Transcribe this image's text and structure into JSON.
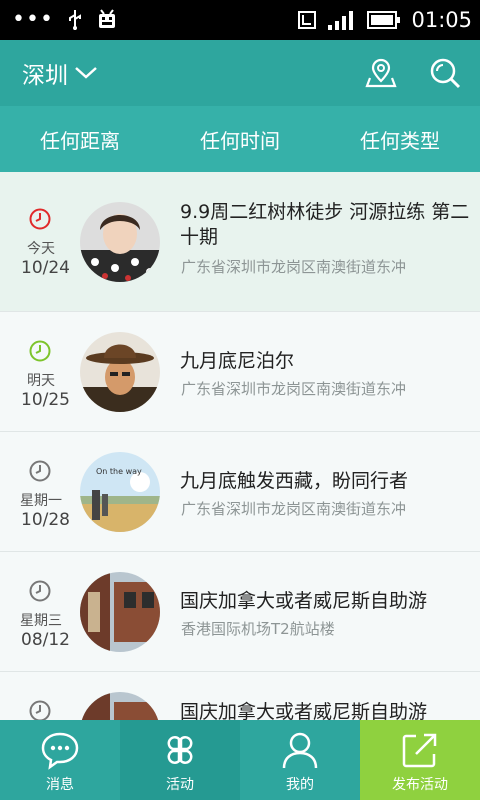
{
  "status_bar": {
    "left_icons": [
      "overflow-dots-icon",
      "usb-icon",
      "android-debug-icon"
    ],
    "right_icons": [
      "vibrate-icon",
      "signal-icon",
      "battery-icon"
    ],
    "time": "01:05"
  },
  "header": {
    "city": "深圳",
    "icons": [
      "location-map-icon",
      "search-icon"
    ]
  },
  "filters": [
    {
      "label": "任何距离"
    },
    {
      "label": "任何时间"
    },
    {
      "label": "任何类型"
    }
  ],
  "activities": [
    {
      "day": "今天",
      "date": "10/24",
      "title": "9.9周二红树林徒步  河源拉练  第二十期",
      "address": "广东省深圳市龙岗区南澳街道东冲",
      "clock_color": "#e02a2a"
    },
    {
      "day": "明天",
      "date": "10/25",
      "title": "九月底尼泊尔",
      "address": "广东省深圳市龙岗区南澳街道东冲",
      "clock_color": "#7dc42b"
    },
    {
      "day": "星期一",
      "date": "10/28",
      "title": "九月底触发西藏，盼同行者",
      "address": "广东省深圳市龙岗区南澳街道东冲",
      "clock_color": "#777777"
    },
    {
      "day": "星期三",
      "date": "08/12",
      "title": "国庆加拿大或者威尼斯自助游",
      "address": "香港国际机场T2航站楼",
      "clock_color": "#777777"
    },
    {
      "day": "",
      "date": "",
      "title": "国庆加拿大或者威尼斯自助游",
      "address": "",
      "clock_color": "#777777"
    }
  ],
  "bottom_nav": [
    {
      "label": "消息",
      "icon": "message-bubble-icon"
    },
    {
      "label": "活动",
      "icon": "activity-grid-icon"
    },
    {
      "label": "我的",
      "icon": "user-profile-icon"
    },
    {
      "label": "发布活动",
      "icon": "publish-share-icon"
    }
  ],
  "colors": {
    "header": "#2ea69e",
    "filter_bar": "#36b1a9",
    "publish": "#8fd13f",
    "highlight_row": "#e8f3ee"
  }
}
